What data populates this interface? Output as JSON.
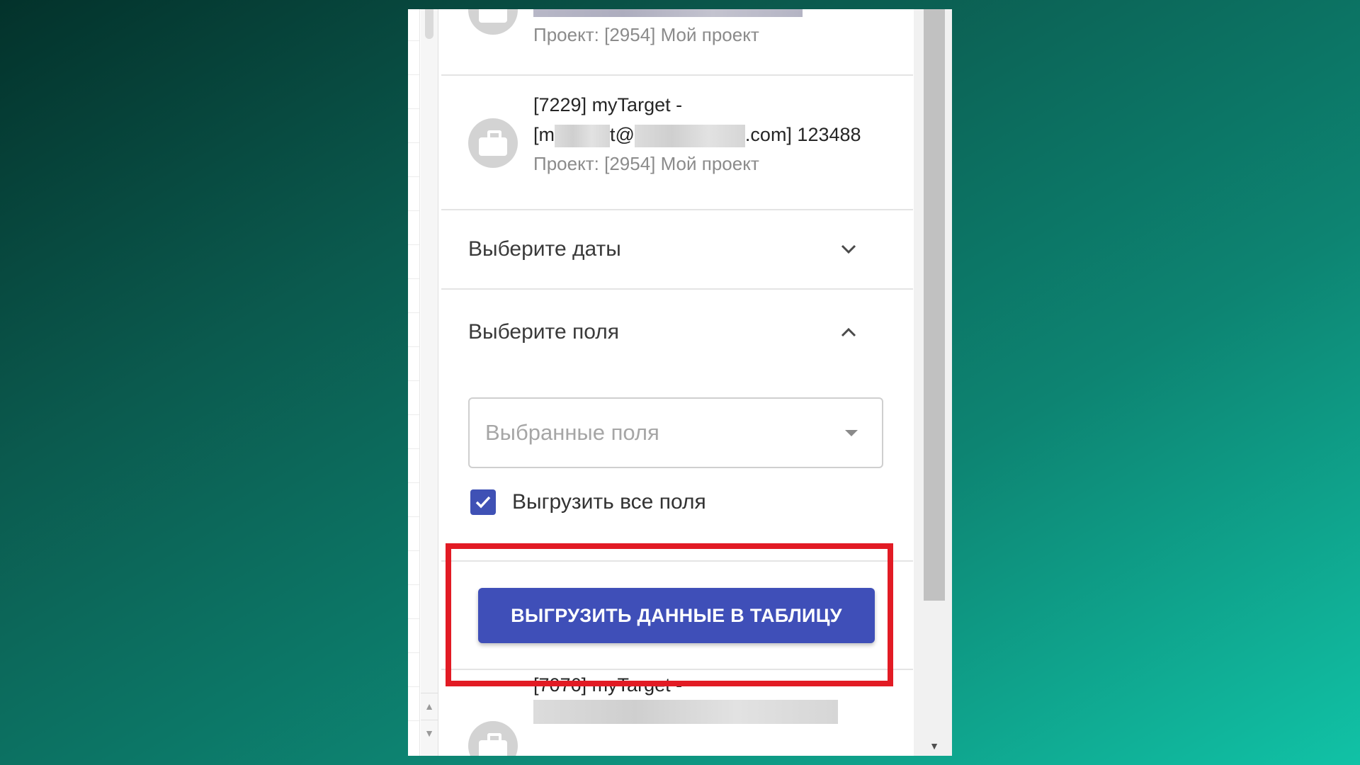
{
  "accounts": [
    {
      "title": "",
      "project": "Проект: [2954] Мой проект"
    },
    {
      "title_prefix": "[7229] myTarget -",
      "title_line2_start": "[m",
      "title_line2_mid": "t@",
      "title_line2_end": ".com] 123488",
      "project": "Проект: [2954] Мой проект"
    },
    {
      "title_prefix": "[7076] myTarget -"
    }
  ],
  "sections": {
    "dates_label": "Выберите даты",
    "fields_label": "Выберите поля"
  },
  "fields_select": {
    "placeholder": "Выбранные поля"
  },
  "export_all_checkbox": {
    "label": "Выгрузить все поля",
    "checked": true
  },
  "export_button": {
    "label": "ВЫГРУЗИТЬ ДАННЫЕ В ТАБЛИЦУ"
  },
  "colors": {
    "primary": "#3f51b5",
    "highlight": "#e21b24"
  },
  "icons": [
    "briefcase-icon",
    "chevron-down-icon",
    "chevron-up-icon",
    "dropdown-caret-icon",
    "checkmark-icon"
  ]
}
